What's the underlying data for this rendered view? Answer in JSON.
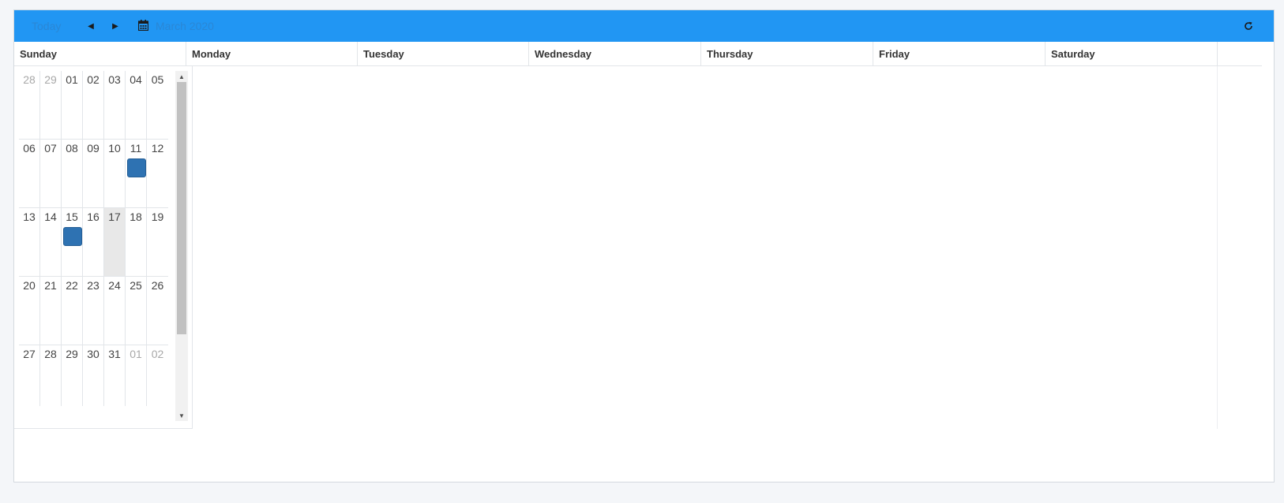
{
  "toolbar": {
    "today_label": "Today",
    "prev_icon": "triangle-left-icon",
    "next_icon": "triangle-right-icon",
    "date_label": "March 2020",
    "calendar_icon": "calendar-icon",
    "refresh_icon": "refresh-icon",
    "background": "#2196f3"
  },
  "week_days": [
    "Sunday",
    "Monday",
    "Tuesday",
    "Wednesday",
    "Thursday",
    "Friday",
    "Saturday"
  ],
  "month_grid": {
    "weeks": [
      [
        "28",
        "29",
        "01",
        "02",
        "03",
        "04",
        "05"
      ],
      [
        "06",
        "07",
        "08",
        "09",
        "10",
        "11",
        "12"
      ],
      [
        "13",
        "14",
        "15",
        "16",
        "17",
        "18",
        "19"
      ],
      [
        "20",
        "21",
        "22",
        "23",
        "24",
        "25",
        "26"
      ],
      [
        "27",
        "28",
        "29",
        "30",
        "31",
        "01",
        "02"
      ]
    ],
    "other_month_days": [
      "28",
      "29",
      "01",
      "02"
    ],
    "today": "17",
    "event_days": [
      "11",
      "15"
    ],
    "event_color": "#2e72b2",
    "today_color": "#e8e8e8"
  }
}
